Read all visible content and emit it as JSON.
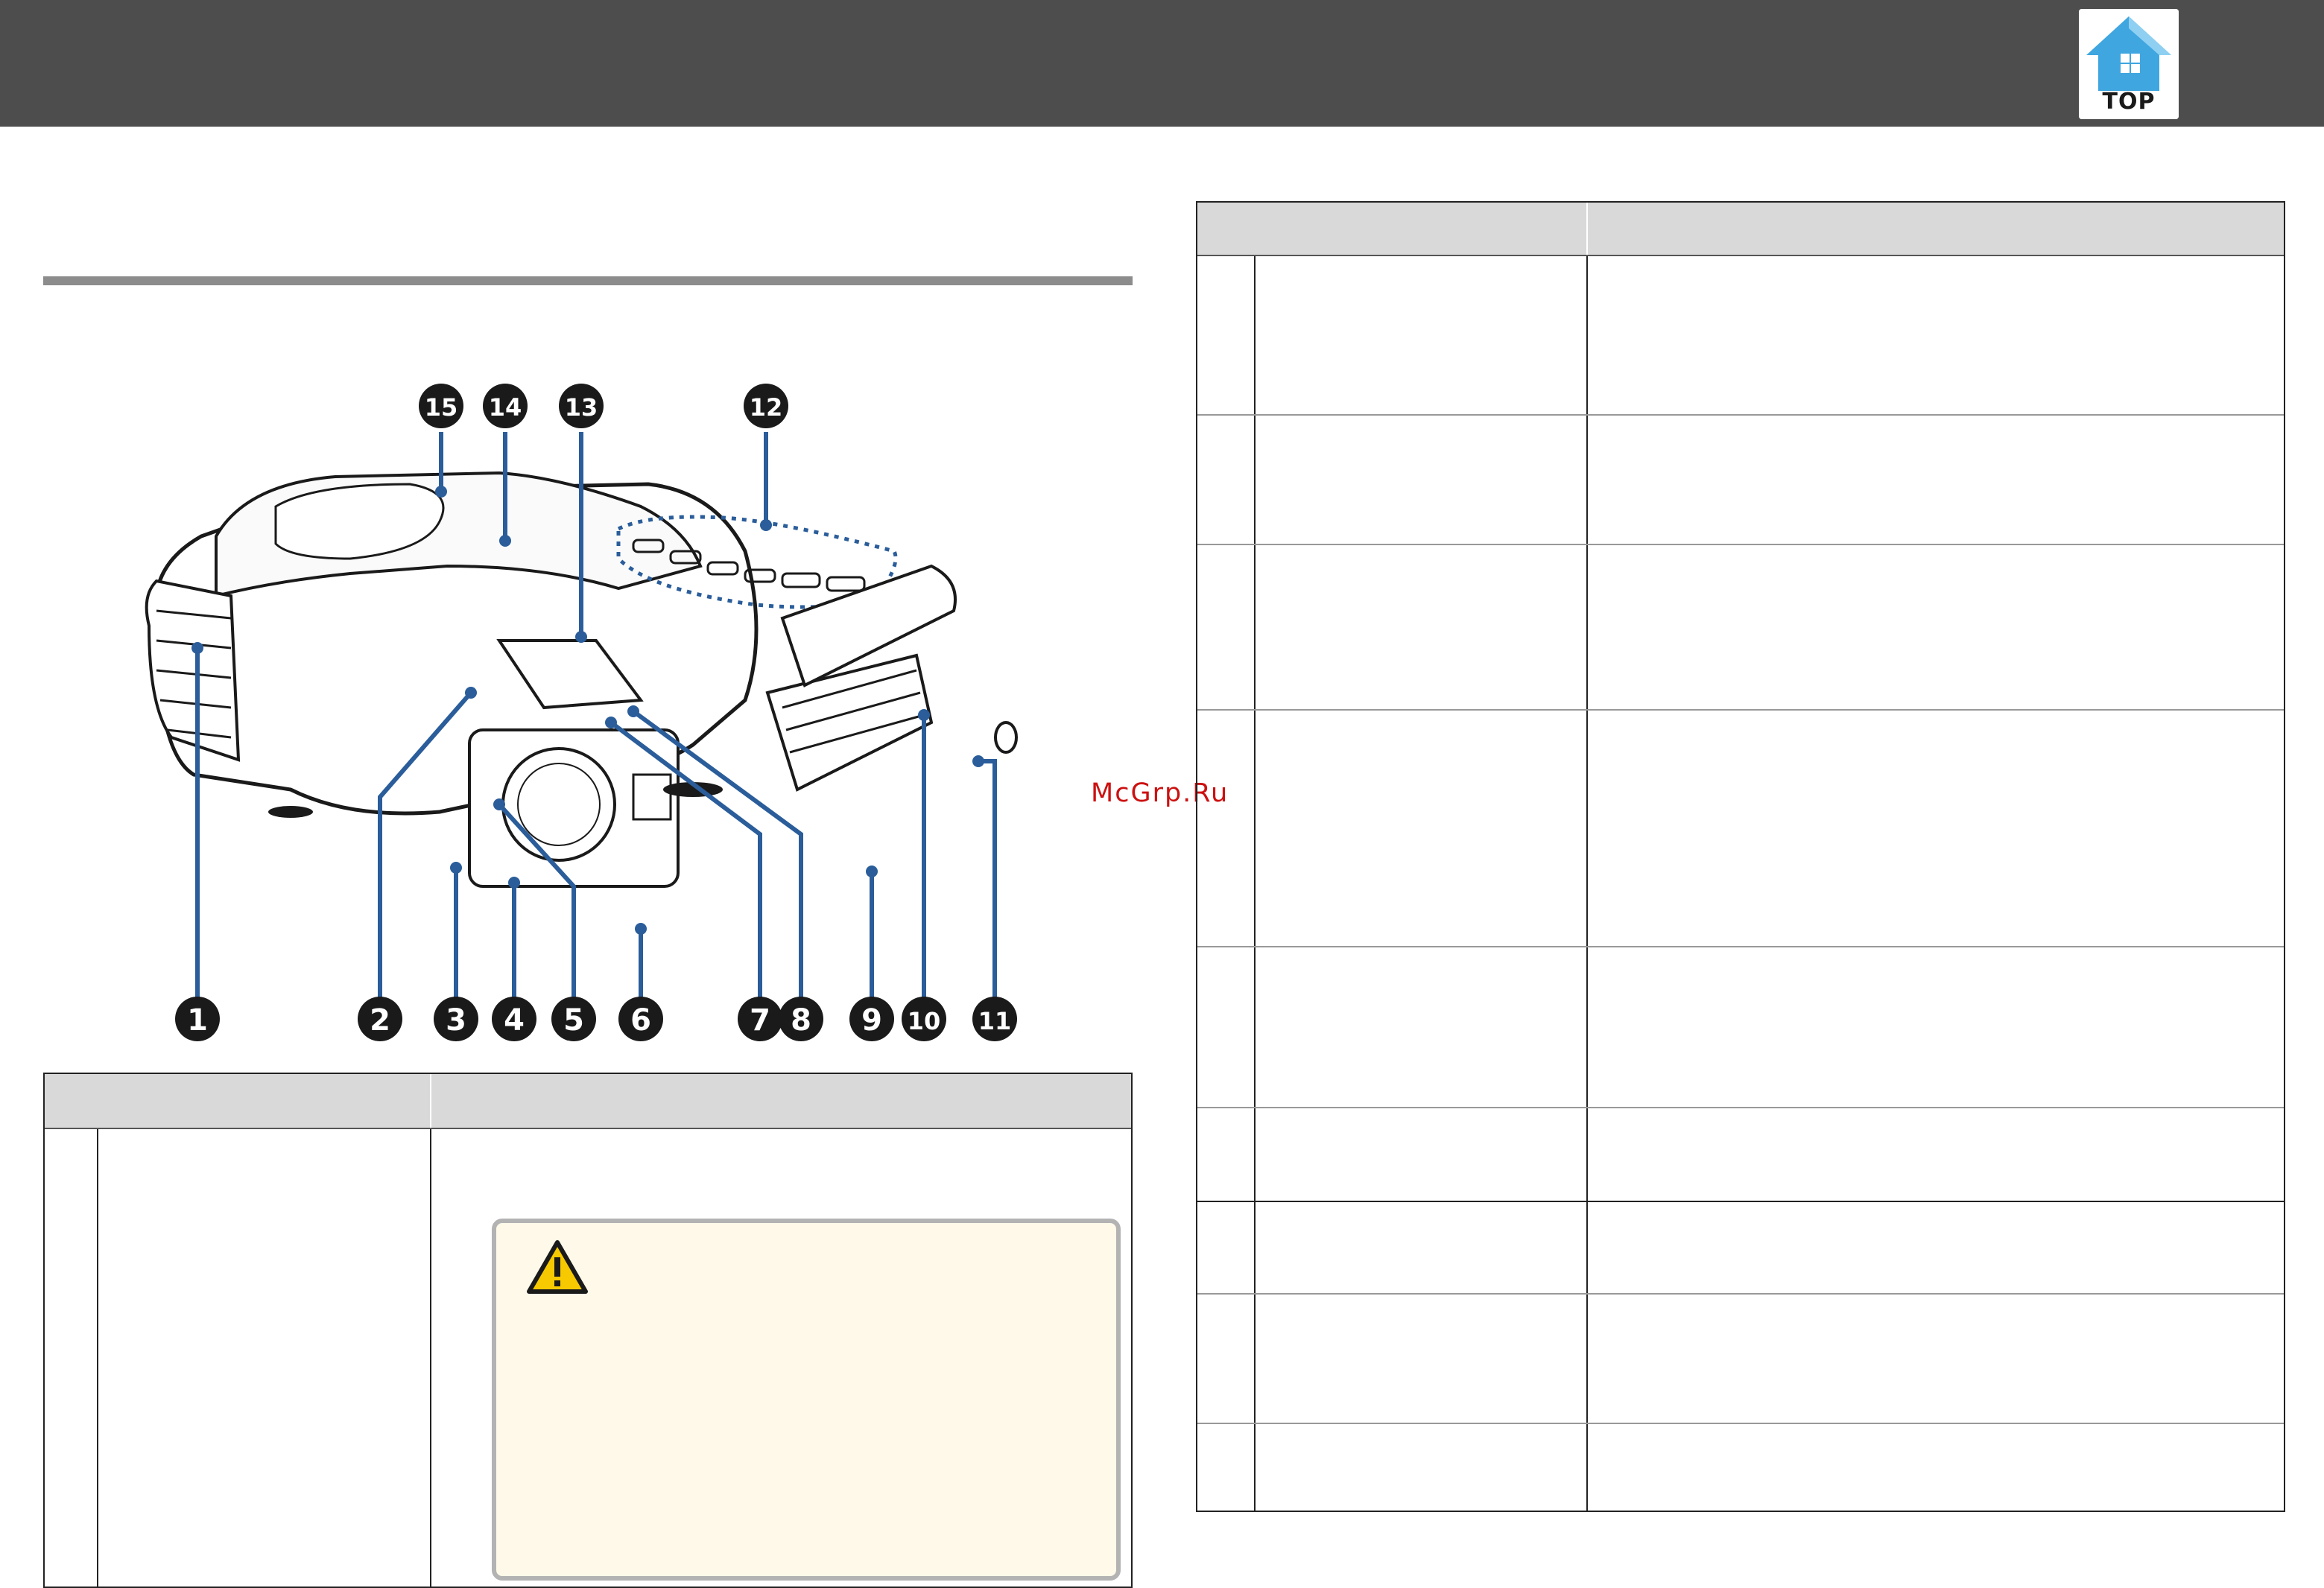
{
  "header": {
    "top_button_label": "TOP"
  },
  "diagram": {
    "callouts_bottom": [
      "1",
      "2",
      "3",
      "4",
      "5",
      "6",
      "7",
      "8",
      "9",
      "10",
      "11"
    ],
    "callouts_top": [
      "15",
      "14",
      "13",
      "12"
    ]
  },
  "watermark": "McGrp.Ru",
  "colors": {
    "header_bg": "#4d4d4d",
    "table_header_bg": "#d9d9d9",
    "callout_blue": "#2a5d9a",
    "caution_bg": "#fef9e8",
    "watermark_red": "#cc1111"
  },
  "icons": {
    "top": "home-top-icon",
    "caution": "warning-triangle-icon"
  }
}
